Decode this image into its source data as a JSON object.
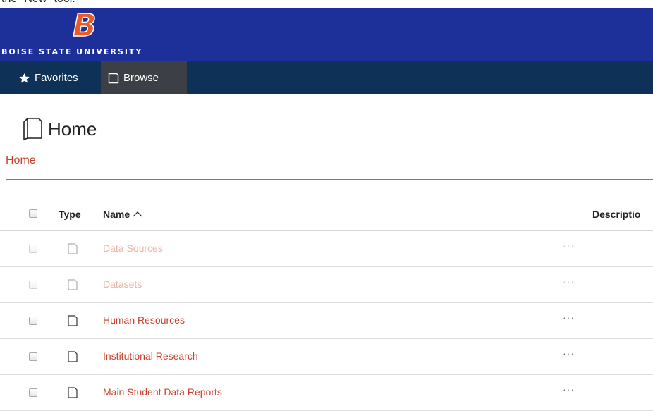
{
  "header": {
    "caption": "the \"New\" tool.",
    "university_name": "BOISE STATE UNIVERSITY",
    "logo_letter": "B"
  },
  "nav": {
    "tabs": [
      {
        "label": "Favorites",
        "icon": "star-icon",
        "active": false
      },
      {
        "label": "Browse",
        "icon": "folder-icon",
        "active": true
      }
    ]
  },
  "page": {
    "title": "Home",
    "breadcrumb": "Home"
  },
  "table": {
    "columns": [
      "Type",
      "Name",
      "Descriptio"
    ],
    "sort_indicator": "ascending",
    "rows": [
      {
        "name": "Data Sources",
        "more": "···",
        "enabled": false
      },
      {
        "name": "Datasets",
        "more": "···",
        "enabled": false
      },
      {
        "name": "Human Resources",
        "more": "···",
        "enabled": true
      },
      {
        "name": "Institutional Research",
        "more": "···",
        "enabled": true
      },
      {
        "name": "Main Student Data Reports",
        "more": "···",
        "enabled": true
      }
    ]
  },
  "colors": {
    "brand_blue": "#1d2f99",
    "nav_navy": "#0e3158",
    "active_tab": "#3c3f45",
    "link_orange": "#c8422a",
    "logo_orange": "#e85a27"
  }
}
